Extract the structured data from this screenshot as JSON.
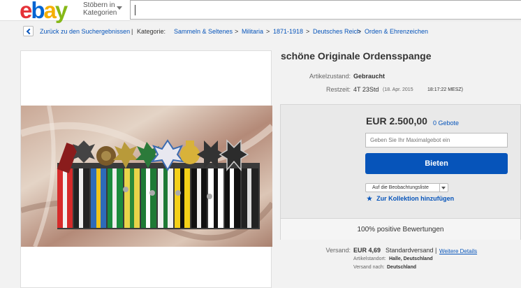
{
  "header": {
    "logo_letters": [
      "e",
      "b",
      "a",
      "y"
    ],
    "logo_colors": [
      "#e53238",
      "#0064d2",
      "#f5af02",
      "#86b817"
    ],
    "browse_line1": "Stöbern in",
    "browse_line2": "Kategorien",
    "search_value": ""
  },
  "breadcrumb": {
    "back_label": "Zurück zu den Suchergebnissen",
    "separator": "|",
    "category_label": "Kategorie:",
    "items": [
      "Sammeln & Seltenes",
      "Militaria",
      "1871-1918",
      "Deutsches Reich",
      "Orden & Ehrenzeichen"
    ],
    "arrow": ">"
  },
  "item": {
    "title": "schöne Originale Ordensspange",
    "condition_label": "Artikelzustand:",
    "condition_value": "Gebraucht",
    "time_label": "Restzeit:",
    "time_value": "4T 23Std",
    "time_detail": "(18. Apr. 2015",
    "time_clock": "18:17:22 MESZ)"
  },
  "bid": {
    "price": "EUR 2.500,00",
    "bid_count": "0 Gebote",
    "max_bid_placeholder": "Geben Sie Ihr Maximalgebot ein",
    "bid_button": "Bieten",
    "watch_label": "Auf die Beobachtungsliste",
    "collection_star": "★",
    "collection_label": "Zur Kollektion hinzufügen",
    "feedback": "100% positive Bewertungen"
  },
  "shipping": {
    "label": "Versand:",
    "price": "EUR 4,69",
    "method": "Standardversand",
    "separator": "|",
    "details_link": "Weitere Details",
    "location_label": "Artikelstandort:",
    "location_value": "Halle, Deutschland",
    "ships_to_label": "Versand nach:",
    "ships_to_value": "Deutschland"
  },
  "colors": {
    "link": "#0654ba",
    "button": "#0654ba"
  }
}
